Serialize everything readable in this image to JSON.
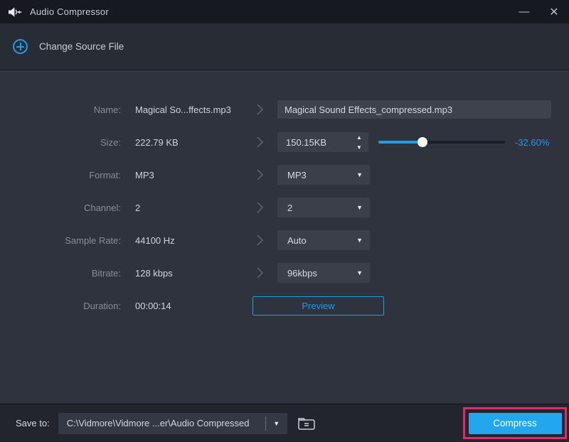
{
  "titlebar": {
    "title": "Audio Compressor",
    "minimize_glyph": "—",
    "close_glyph": "✕"
  },
  "header": {
    "change_source_label": "Change Source File"
  },
  "form": {
    "name": {
      "label": "Name:",
      "original": "Magical So...ffects.mp3",
      "output": "Magical Sound Effects_compressed.mp3"
    },
    "size": {
      "label": "Size:",
      "original": "222.79 KB",
      "target": "150.15KB",
      "reduction": "-32.60%",
      "slider_percent": 35
    },
    "format": {
      "label": "Format:",
      "original": "MP3",
      "selected": "MP3"
    },
    "channel": {
      "label": "Channel:",
      "original": "2",
      "selected": "2"
    },
    "sample_rate": {
      "label": "Sample Rate:",
      "original": "44100 Hz",
      "selected": "Auto"
    },
    "bitrate": {
      "label": "Bitrate:",
      "original": "128 kbps",
      "selected": "96kbps"
    },
    "duration": {
      "label": "Duration:",
      "original": "00:00:14",
      "preview_label": "Preview"
    }
  },
  "footer": {
    "save_to_label": "Save to:",
    "save_path": "C:\\Vidmore\\Vidmore ...er\\Audio Compressed",
    "compress_label": "Compress"
  },
  "glyphs": {
    "dropdown_arrow": "▼",
    "spin_up": "▲",
    "spin_down": "▼"
  },
  "colors": {
    "accent_blue": "#1E9DE8",
    "compress_button_blue": "#22A7EE",
    "annotation_pink": "#E22A68",
    "reduction_text_blue": "#2196F3",
    "main_background": "#2F333D",
    "titlebar_background": "#16191F",
    "footer_background": "#22252D"
  }
}
